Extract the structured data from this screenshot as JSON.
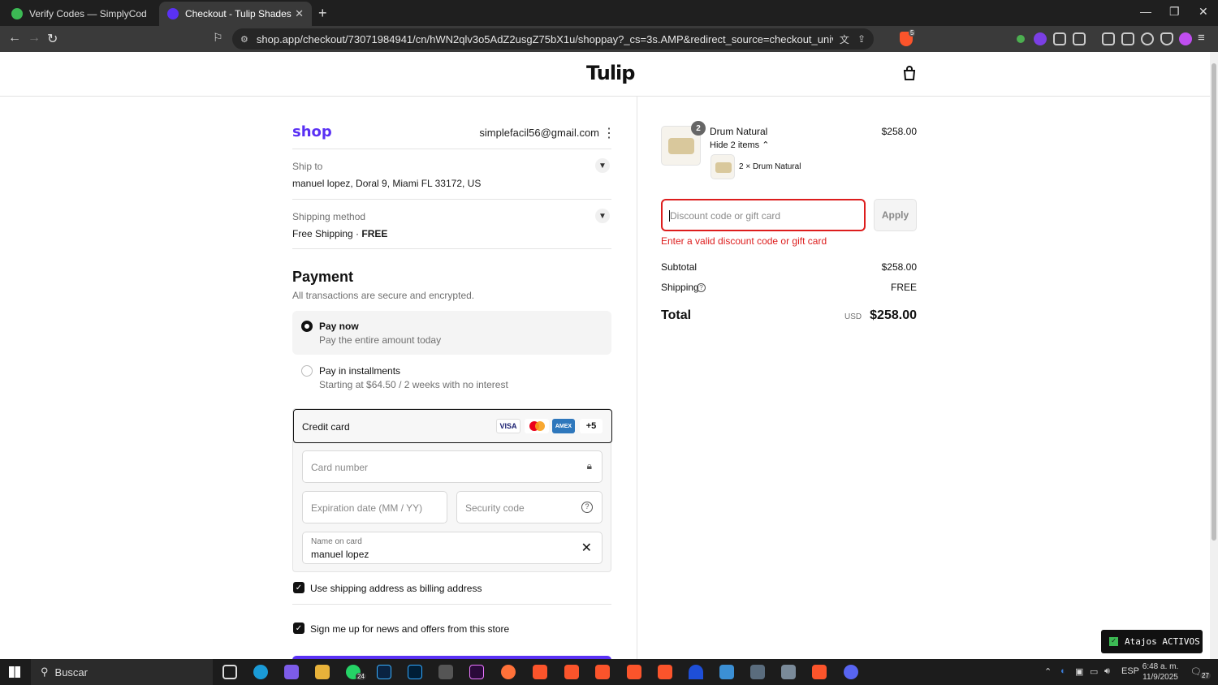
{
  "browser": {
    "tabs": [
      {
        "title": "Verify Codes — SimplyCodes"
      },
      {
        "title": "Checkout - Tulip Shades"
      }
    ],
    "url": "shop.app/checkout/73071984941/cn/hWN2qlv3o5AdZ2usgZ75bX1u/shoppay?_cs=3s.AMP&redirect_source=checkout_universal_redirect&tracking_u...",
    "brave_badge": "5"
  },
  "header": {
    "logo": "Tulip"
  },
  "left": {
    "shop_logo": "shop",
    "email": "simplefacil56@gmail.com",
    "ship_to_label": "Ship to",
    "ship_to_value": "manuel lopez, Doral 9, Miami FL 33172, US",
    "shipping_method_label": "Shipping method",
    "shipping_method_value": "Free Shipping",
    "shipping_method_price": "FREE",
    "payment_title": "Payment",
    "payment_subtitle": "All transactions are secure and encrypted.",
    "options": [
      {
        "title": "Pay now",
        "subtitle": "Pay the entire amount today",
        "selected": true
      },
      {
        "title": "Pay in installments",
        "subtitle": "Starting at $64.50 / 2 weeks with no interest",
        "selected": false
      }
    ],
    "credit_card_label": "Credit card",
    "card_brands": [
      "VISA",
      "AMEX",
      "+5"
    ],
    "card_number_placeholder": "Card number",
    "expiration_placeholder": "Expiration date (MM / YY)",
    "security_placeholder": "Security code",
    "name_label": "Name on card",
    "name_value": "manuel lopez",
    "billing_checkbox": "Use shipping address as billing address",
    "news_checkbox": "Sign me up for news and offers from this store"
  },
  "right": {
    "product_name": "Drum Natural",
    "quantity_badge": "2",
    "hide_items": "Hide 2 items",
    "sub_item": "2 × Drum Natural",
    "product_price": "$258.00",
    "discount_placeholder": "Discount code or gift card",
    "apply_label": "Apply",
    "error_text": "Enter a valid discount code or gift card",
    "subtotal_label": "Subtotal",
    "subtotal_value": "$258.00",
    "shipping_label": "Shipping",
    "shipping_value": "FREE",
    "total_label": "Total",
    "currency": "USD",
    "total_value": "$258.00"
  },
  "overlay": {
    "atajos": "Atajos ACTIVOS"
  },
  "taskbar": {
    "search": "Buscar",
    "whatsapp_badge": "24",
    "lang": "ESP",
    "time": "6:48 a. m.",
    "date": "11/9/2025",
    "notif": "27"
  }
}
